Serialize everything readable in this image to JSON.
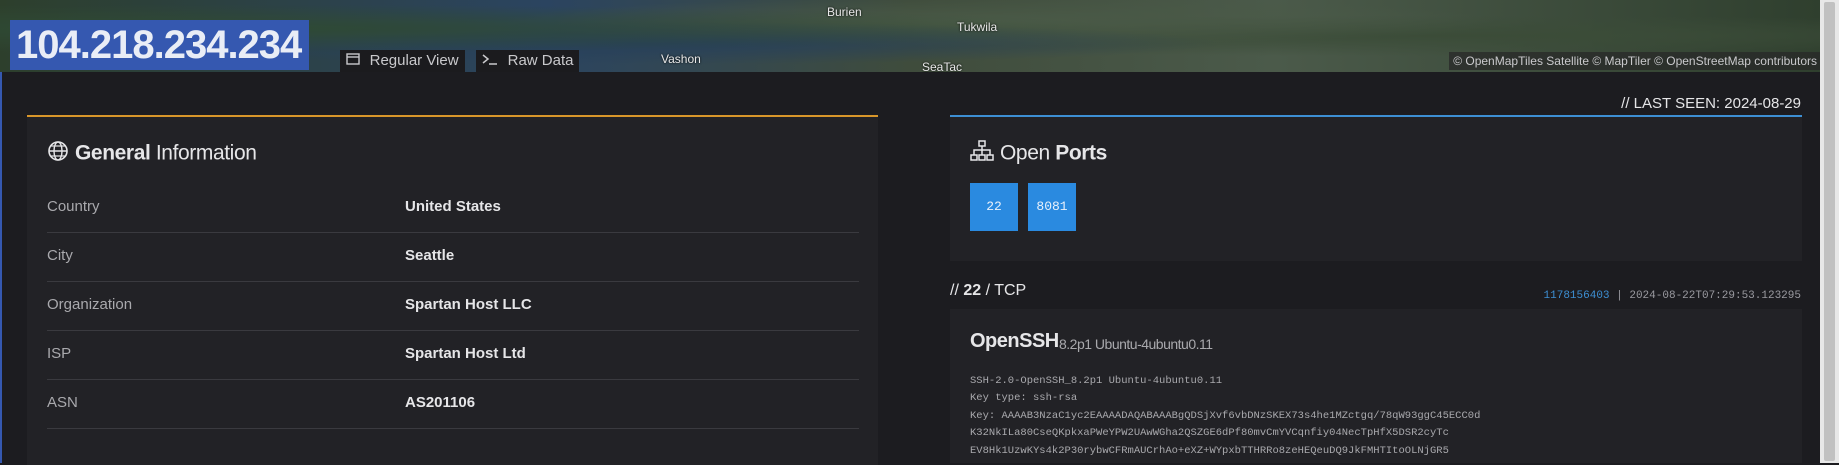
{
  "map": {
    "places": [
      "Burien",
      "Tukwila",
      "Vashon",
      "SeaTac"
    ],
    "attribution": "© OpenMapTiles Satellite © MapTiler © OpenStreetMap contributors"
  },
  "header": {
    "ip": "104.218.234.234",
    "regular_view": "Regular View",
    "raw_data": "Raw Data"
  },
  "general": {
    "title_bold": "General",
    "title_rest": "Information",
    "rows": [
      {
        "key": "Country",
        "value": "United States"
      },
      {
        "key": "City",
        "value": "Seattle"
      },
      {
        "key": "Organization",
        "value": "Spartan Host LLC"
      },
      {
        "key": "ISP",
        "value": "Spartan Host Ltd"
      },
      {
        "key": "ASN",
        "value": "AS201106"
      }
    ]
  },
  "last_seen": "// LAST SEEN: 2024-08-29",
  "ports": {
    "title_light": "Open",
    "title_bold": "Ports",
    "list": [
      "22",
      "8081"
    ]
  },
  "port_detail": {
    "prefix": "//",
    "port": "22",
    "proto": "/ TCP",
    "hash": "1178156403",
    "separator": "|",
    "timestamp": "2024-08-22T07:29:53.123295",
    "service": "OpenSSH",
    "version": "8.2p1 Ubuntu-4ubuntu0.11",
    "banner": [
      "SSH-2.0-OpenSSH_8.2p1 Ubuntu-4ubuntu0.11",
      "Key type: ssh-rsa",
      "Key: AAAAB3NzaC1yc2EAAAADAQABAAABgQDSjXvf6vbDNzSKEX73s4he1MZctgq/78qW93ggC45ECC0d",
      "K32NkILa80CseQKpkxaPWeYPW2UAwWGha2QSZGE6dPf80mvCmYVCqnfiy04NecTpHfX5DSR2cyTc",
      "EV8Hk1UzwKYs4k2P30rybwCFRmAUCrhAo+eXZ+WYpxbTTHRRo8zeHEQeuDQ9JkFMHTItoOLNjGR5"
    ]
  },
  "colors": {
    "accent_orange": "#d8962a",
    "accent_blue": "#3d8fd3",
    "ip_highlight": "#3558b0",
    "port_button": "#2a8ae0"
  }
}
